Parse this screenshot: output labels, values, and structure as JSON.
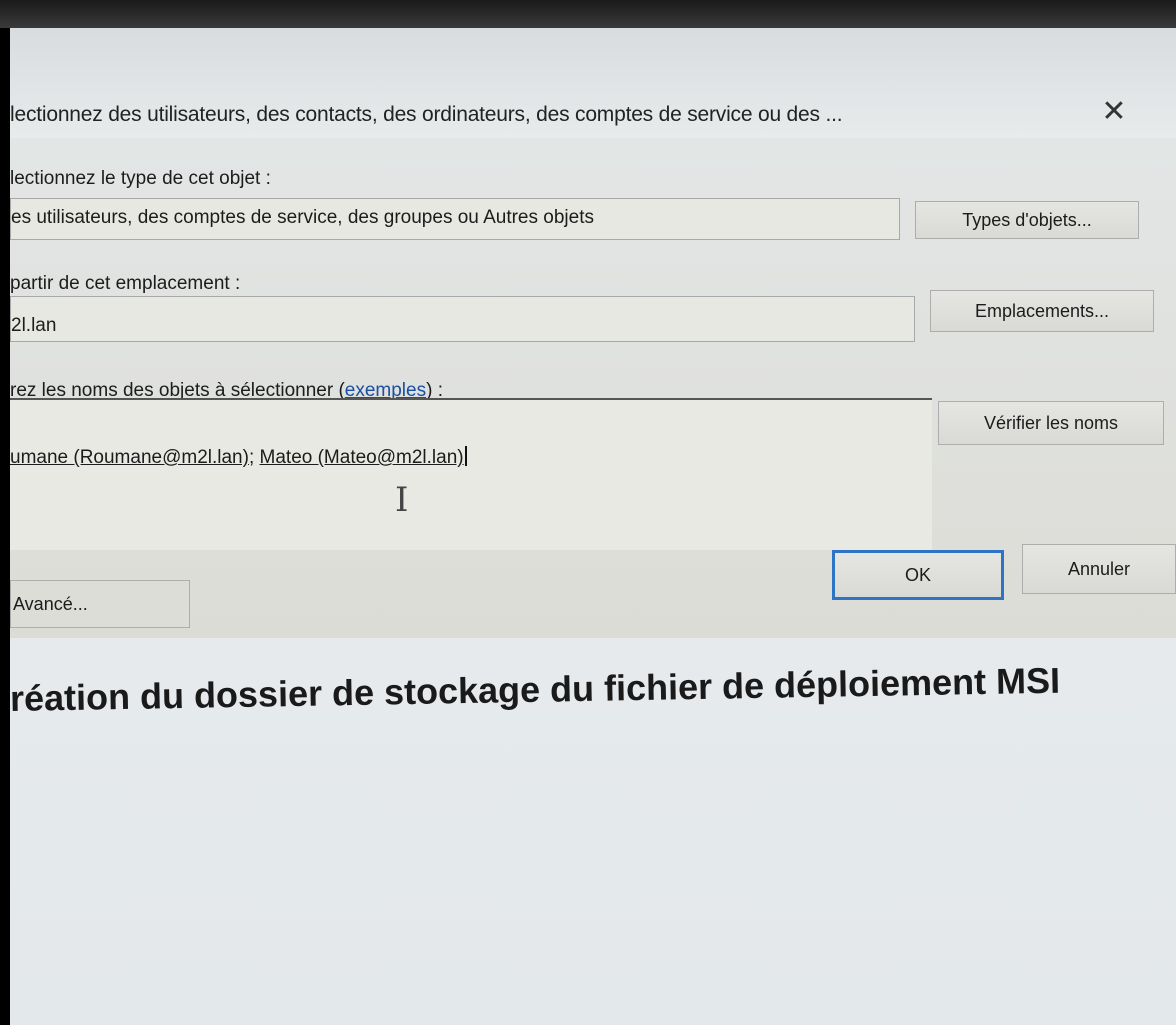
{
  "dialog": {
    "title": "lectionnez des utilisateurs, des contacts, des ordinateurs, des comptes de service ou des ...",
    "object_type": {
      "label": "lectionnez le type de cet objet :",
      "value": "es utilisateurs, des comptes de service, des groupes ou Autres objets",
      "button": "Types d'objets..."
    },
    "location": {
      "label": "partir de cet emplacement :",
      "value": "2l.lan",
      "button": "Emplacements..."
    },
    "names": {
      "label_prefix": "rez les noms des objets à sélectionner (",
      "label_link": "exemples",
      "label_suffix": ") :",
      "entry_1": "umane (Roumane@m2l.lan)",
      "separator": "; ",
      "entry_2": "Mateo (Mateo@m2l.lan)",
      "button": "Vérifier les noms"
    },
    "advanced_button": "Avancé...",
    "ok_button": "OK",
    "cancel_button": "Annuler"
  },
  "document": {
    "heading": "réation du dossier de stockage du fichier de déploiement MSI"
  },
  "colors": {
    "accent": "#2f73c4",
    "link": "#1a4fa3"
  },
  "icons": [
    "close-icon",
    "text-cursor-icon"
  ]
}
